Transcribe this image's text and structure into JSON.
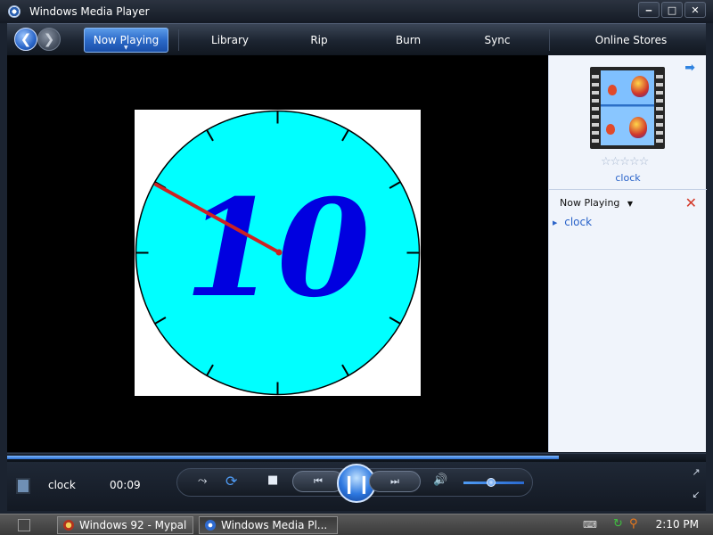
{
  "window": {
    "title": "Windows Media Player",
    "buttons": {
      "minimize": "‒",
      "maximize": "□",
      "close": "✕"
    }
  },
  "nav": {
    "tabs": [
      {
        "label": "Now Playing"
      },
      {
        "label": "Library"
      },
      {
        "label": "Rip"
      },
      {
        "label": "Burn"
      },
      {
        "label": "Sync"
      },
      {
        "label": "Online Stores"
      }
    ]
  },
  "video": {
    "clock_number": "10",
    "clock_face_color": "#00FFFF",
    "number_color": "#0000E0",
    "hand_color": "#CC2222"
  },
  "pane": {
    "album_caption": "clock",
    "rating_stars": "☆☆☆☆☆",
    "now_playing_label": "Now Playing",
    "playlist": [
      {
        "label": "clock"
      }
    ]
  },
  "controls": {
    "media_title": "clock",
    "elapsed_time": "00:09",
    "seek_progress_fraction": 0.79,
    "volume_fraction": 0.45
  },
  "taskbar": {
    "tasks": [
      {
        "label": "Windows 92 - Mypal"
      },
      {
        "label": "Windows Media Pl..."
      }
    ],
    "clock": "2:10 PM"
  },
  "colors": {
    "accent": "#2a6ad0",
    "link": "#2a63c9"
  }
}
